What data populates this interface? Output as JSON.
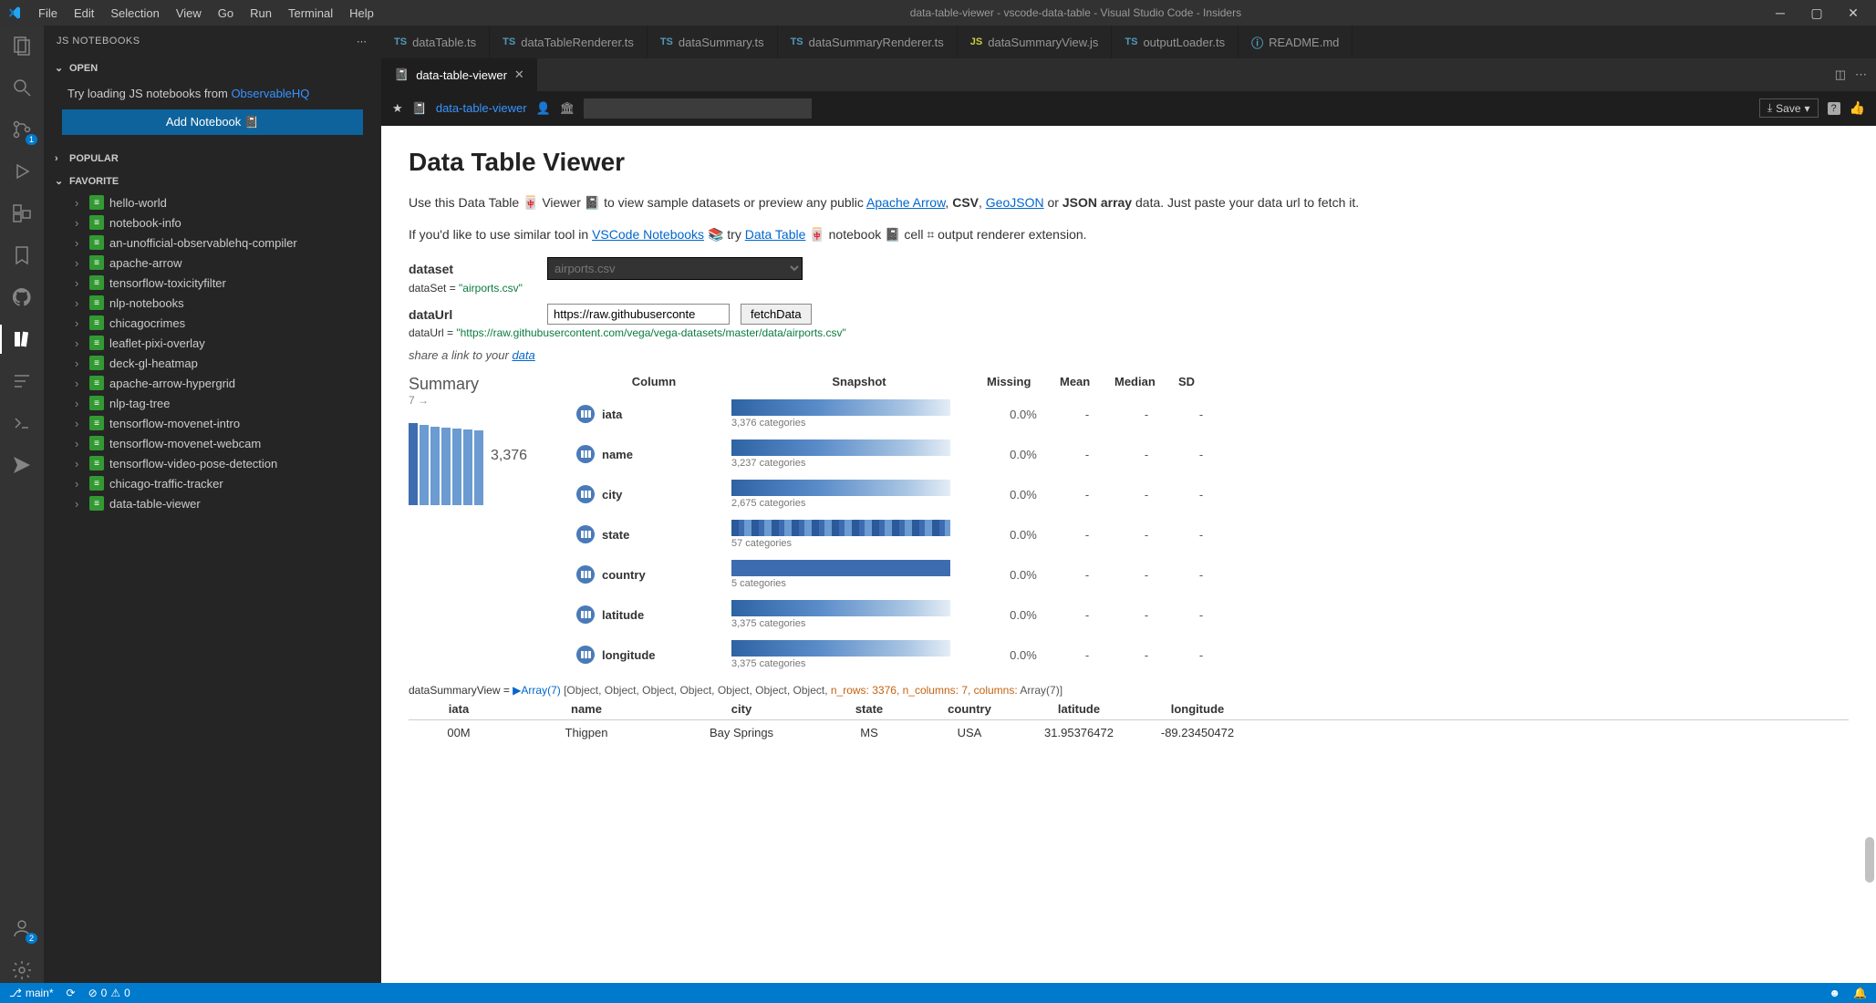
{
  "window": {
    "title": "data-table-viewer - vscode-data-table - Visual Studio Code - Insiders"
  },
  "menus": [
    "File",
    "Edit",
    "Selection",
    "View",
    "Go",
    "Run",
    "Terminal",
    "Help"
  ],
  "sidebar": {
    "title": "JS NOTEBOOKS",
    "open_label": "OPEN",
    "hint_prefix": "Try loading JS notebooks from ",
    "hint_link": "ObservableHQ",
    "add_btn": "Add Notebook 📓",
    "popular_label": "POPULAR",
    "favorite_label": "FAVORITE",
    "favorites": [
      "hello-world",
      "notebook-info",
      "an-unofficial-observablehq-compiler",
      "apache-arrow",
      "tensorflow-toxicityfilter",
      "nlp-notebooks",
      "chicagocrimes",
      "leaflet-pixi-overlay",
      "deck-gl-heatmap",
      "apache-arrow-hypergrid",
      "nlp-tag-tree",
      "tensorflow-movenet-intro",
      "tensorflow-movenet-webcam",
      "tensorflow-video-pose-detection",
      "chicago-traffic-tracker",
      "data-table-viewer"
    ]
  },
  "editor_tabs": [
    {
      "kind": "ts",
      "label": "dataTable.ts"
    },
    {
      "kind": "ts",
      "label": "dataTableRenderer.ts"
    },
    {
      "kind": "ts",
      "label": "dataSummary.ts"
    },
    {
      "kind": "ts",
      "label": "dataSummaryRenderer.ts"
    },
    {
      "kind": "js",
      "label": "dataSummaryView.js"
    },
    {
      "kind": "ts",
      "label": "outputLoader.ts"
    },
    {
      "kind": "info",
      "label": "README.md"
    }
  ],
  "editor_tab2": "data-table-viewer",
  "breadcrumb": {
    "link": "data-table-viewer",
    "save": "Save"
  },
  "doc": {
    "h1": "Data Table Viewer",
    "p1a": "Use this Data Table 🀄 Viewer 📓 to view sample datasets or preview any public ",
    "p1_link1": "Apache Arrow",
    "p1b": ", ",
    "p1_csv": "CSV",
    "p1c": ", ",
    "p1_link2": "GeoJSON",
    "p1d": " or ",
    "p1_json": "JSON array",
    "p1e": " data. Just paste your data url to fetch it.",
    "p2a": "If you'd like to use similar tool in ",
    "p2_link1": "VSCode Notebooks",
    "p2b": " 📚 try ",
    "p2_link2": "Data Table",
    "p2c": " 🀄 notebook 📓 cell ⌗ output renderer extension.",
    "dataset_label": "dataset",
    "dataset_value": "airports.csv",
    "dataset_code_key": "dataSet = ",
    "dataset_code_val": "\"airports.csv\"",
    "dataurl_label": "dataUrl",
    "dataurl_value": "https://raw.githubuserconte",
    "fetch_btn": "fetchData",
    "dataurl_code_key": "dataUrl = ",
    "dataurl_code_val": "\"https://raw.githubusercontent.com/vega/vega-datasets/master/data/airports.csv\"",
    "share_a": "share a link to your ",
    "share_link": "data"
  },
  "summary": {
    "title": "Summary",
    "cols": "7 →",
    "count": "3,376",
    "headers": [
      "Column",
      "Snapshot",
      "Missing",
      "Mean",
      "Median",
      "SD"
    ],
    "rows": [
      {
        "name": "iata",
        "cats": "3,376 categories",
        "missing": "0.0%",
        "mean": "-",
        "median": "-",
        "sd": "-",
        "bar": "grad"
      },
      {
        "name": "name",
        "cats": "3,237 categories",
        "missing": "0.0%",
        "mean": "-",
        "median": "-",
        "sd": "-",
        "bar": "grad"
      },
      {
        "name": "city",
        "cats": "2,675 categories",
        "missing": "0.0%",
        "mean": "-",
        "median": "-",
        "sd": "-",
        "bar": "grad"
      },
      {
        "name": "state",
        "cats": "57 categories",
        "missing": "0.0%",
        "mean": "-",
        "median": "-",
        "sd": "-",
        "bar": "stripe"
      },
      {
        "name": "country",
        "cats": "5 categories",
        "missing": "0.0%",
        "mean": "-",
        "median": "-",
        "sd": "-",
        "bar": "flat"
      },
      {
        "name": "latitude",
        "cats": "3,375 categories",
        "missing": "0.0%",
        "mean": "-",
        "median": "-",
        "sd": "-",
        "bar": "grad"
      },
      {
        "name": "longitude",
        "cats": "3,375 categories",
        "missing": "0.0%",
        "mean": "-",
        "median": "-",
        "sd": "-",
        "bar": "grad"
      }
    ]
  },
  "ds_code": {
    "prefix": "dataSummaryView = ",
    "arr": "▶Array(7)",
    "body": " [Object, Object, Object, Object, Object, Object, Object, ",
    "nrows_k": "n_rows:",
    "nrows_v": " 3376",
    "ncols_k": ", n_columns:",
    "ncols_v": " 7",
    "cols_k": ", columns:",
    "cols_v": " Array(7)]"
  },
  "data_table": {
    "headers": [
      "iata",
      "name",
      "city",
      "state",
      "country",
      "latitude",
      "longitude"
    ],
    "row": [
      "00M",
      "Thigpen",
      "Bay Springs",
      "MS",
      "USA",
      "31.95376472",
      "-89.23450472"
    ]
  },
  "status": {
    "branch": "main*",
    "sync": "⟳",
    "err": "0",
    "warn": "0"
  },
  "activity_badges": {
    "scm": "1",
    "accounts": "2"
  }
}
